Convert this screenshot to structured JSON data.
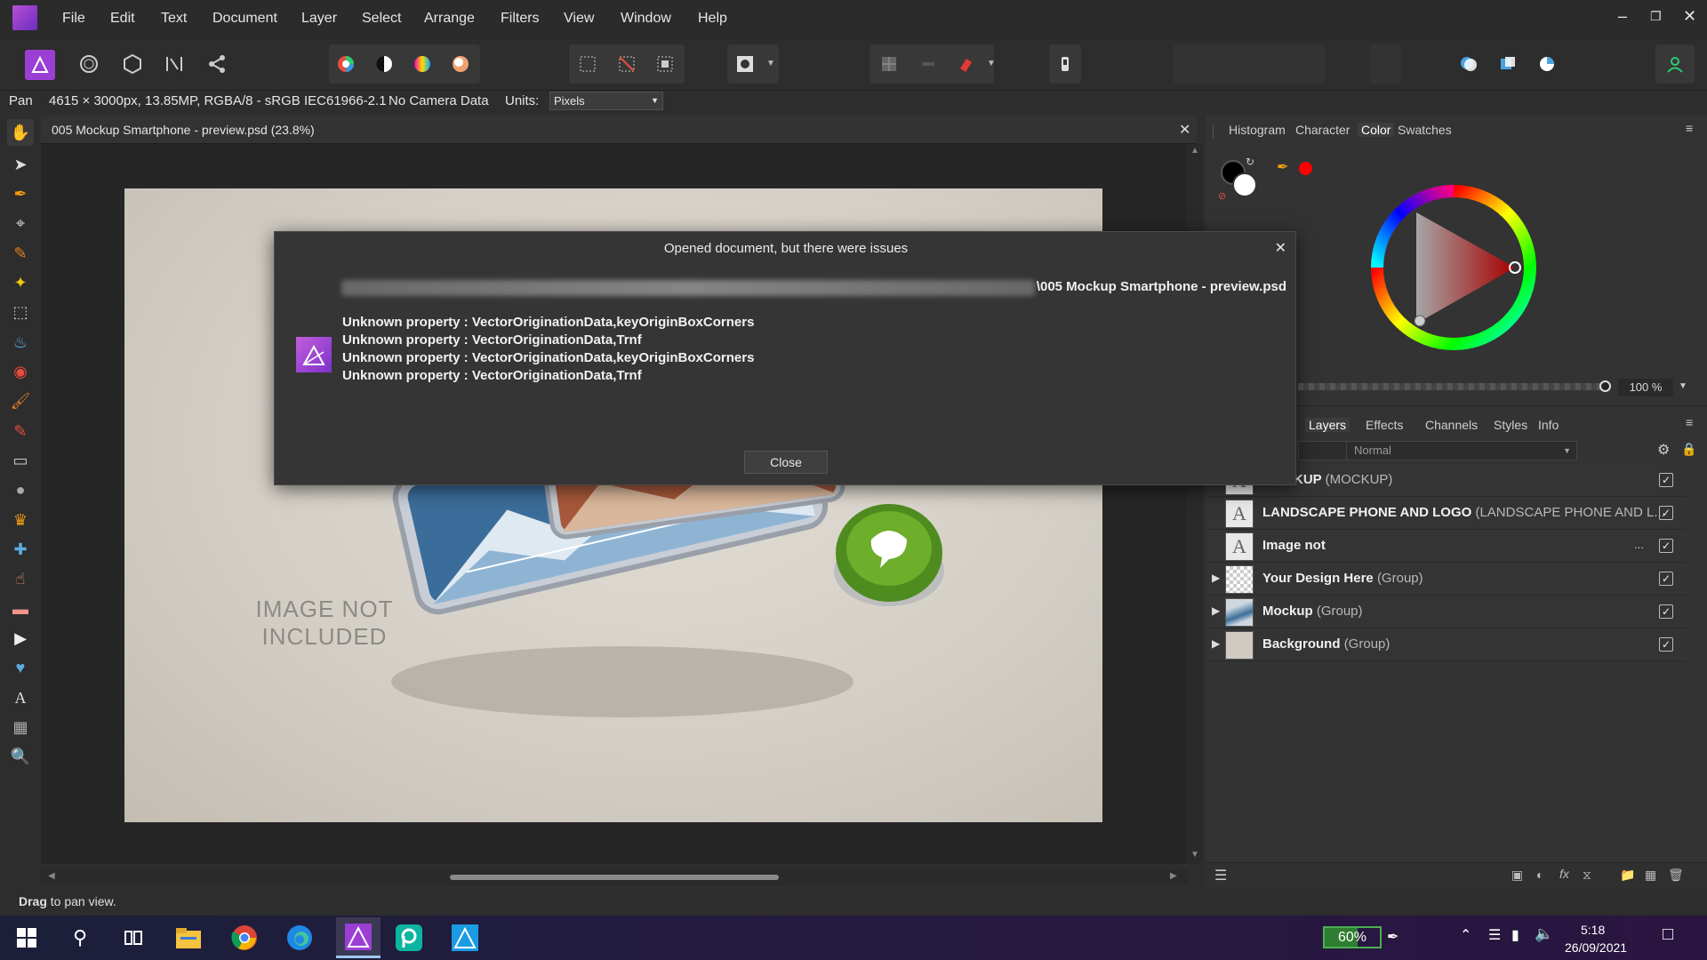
{
  "menu": [
    "File",
    "Edit",
    "Text",
    "Document",
    "Layer",
    "Select",
    "Arrange",
    "Filters",
    "View",
    "Window",
    "Help"
  ],
  "context": {
    "tool": "Pan",
    "doc_info": "4615 × 3000px, 13.85MP, RGBA/8 - sRGB IEC61966-2.1",
    "camera": "No Camera Data",
    "units_label": "Units:",
    "units_value": "Pixels"
  },
  "document": {
    "tab_title": "005 Mockup Smartphone - preview.psd (23.8%)",
    "canvas_text": "IMAGE NOT\nINCLUDED"
  },
  "right_panel": {
    "top_tabs": [
      "Histogram",
      "Character",
      "Color",
      "Swatches"
    ],
    "active_top_tab": "Color",
    "opacity": "100 %",
    "layer_tabs": [
      "Layers",
      "Effects",
      "Channels",
      "Styles",
      "Info"
    ],
    "blend_mode": "Normal",
    "layers": [
      {
        "name": "MOCKUP",
        "type": "(MOCKUP)",
        "thumb": "text",
        "expand": false
      },
      {
        "name": "LANDSCAPE PHONE AND LOGO",
        "type": "(LANDSCAPE PHONE AND L...",
        "thumb": "text",
        "expand": false
      },
      {
        "name": "Image not",
        "type": "",
        "thumb": "text",
        "expand": false
      },
      {
        "name": "Your Design Here",
        "type": "(Group)",
        "thumb": "checker",
        "expand": true
      },
      {
        "name": "Mockup",
        "type": "(Group)",
        "thumb": "image",
        "expand": true
      },
      {
        "name": "Background",
        "type": "(Group)",
        "thumb": "grey",
        "expand": true
      }
    ]
  },
  "dialog": {
    "title": "Opened document, but there were issues",
    "path_visible": "\\005 Mockup Smartphone - preview.psd",
    "messages": [
      "Unknown property : VectorOriginationData,keyOriginBoxCorners",
      "Unknown property : VectorOriginationData,Trnf",
      "Unknown property : VectorOriginationData,keyOriginBoxCorners",
      "Unknown property : VectorOriginationData,Trnf"
    ],
    "close_label": "Close"
  },
  "status": {
    "bold": "Drag",
    "rest": " to pan view."
  },
  "taskbar": {
    "battery": "60%",
    "time": "5:18",
    "date": "26/09/2021"
  },
  "colors": {
    "accent_purple": "#9b3fd4",
    "primary_color": "#ff0000"
  }
}
